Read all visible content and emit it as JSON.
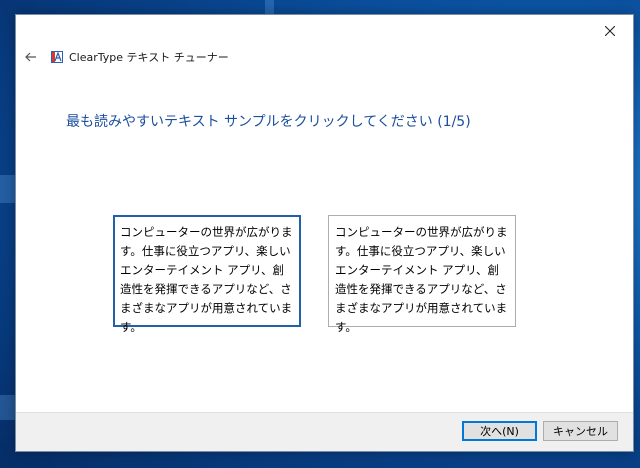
{
  "window": {
    "title": "ClearType テキスト チューナー",
    "heading": "最も読みやすいテキスト サンプルをクリックしてください (1/5)"
  },
  "samples": [
    {
      "text": "コンピューターの世界が広がります。仕事に役立つアプリ、楽しいエンターテイメント アプリ、創造性を発揮できるアプリなど、さまざまなアプリが用意されています。",
      "selected": true
    },
    {
      "text": "コンピューターの世界が広がります。仕事に役立つアプリ、楽しいエンターテイメント アプリ、創造性を発揮できるアプリなど、さまざまなアプリが用意されています。",
      "selected": false
    }
  ],
  "buttons": {
    "next": "次へ(N)",
    "cancel": "キャンセル"
  },
  "colors": {
    "heading": "#1b4f9c",
    "selected_border": "#2460a7",
    "default_button_border": "#0078d7"
  },
  "icons": {
    "back": "back-arrow-icon",
    "close": "close-icon",
    "app": "cleartype-app-icon"
  }
}
